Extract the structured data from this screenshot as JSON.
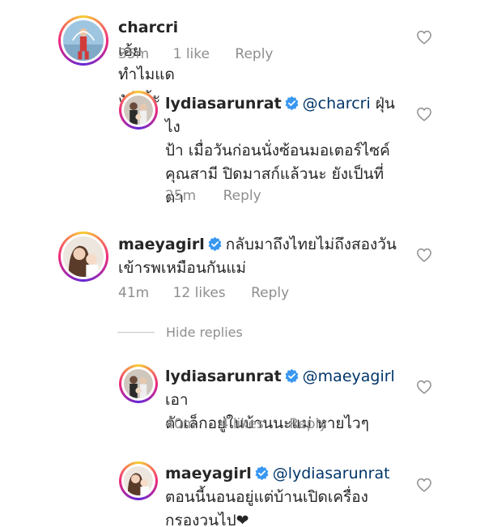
{
  "comments": [
    {
      "username": "charcri",
      "text": "เอ้ยทำไมแดงอ่ะจ้ะ",
      "time": "35m",
      "likes": "1 like",
      "reply_label": "Reply"
    },
    {
      "username": "lydiasarunrat",
      "mention": "@charcri",
      "line1": "ฝุ่นไง",
      "line2": "ป้า เมื่อวันก่อนนั่งซ้อนมอเตอร์ไซค์",
      "line3": "คุณสามี ปิดมาสก์แล้วนะ ยังเป็นที่",
      "line4": "ตา",
      "time": "25m",
      "reply_label": "Reply"
    },
    {
      "username": "maeyagirl",
      "line1": "กลับมาถึงไทยไม่ถึงสองวัน",
      "line2": "เข้ารพเหมือนกันแม่",
      "time": "41m",
      "likes": "12 likes",
      "reply_label": "Reply"
    },
    {
      "username": "lydiasarunrat",
      "mention": "@maeyagirl",
      "line1": "เอา",
      "line2": "ตัวเล็กอยู่ในบ้านนะแม่ หายไวๆ",
      "time": "40m",
      "likes": "4 likes",
      "reply_label": "Reply"
    },
    {
      "username": "maeyagirl",
      "mention": "@lydiasarunrat",
      "line2": "ตอนนี้นอนอยู่แต่บ้านเปิดเครื่อง",
      "line3": "กรองวนไป❤",
      "time": "",
      "reply_label": ""
    }
  ],
  "hide_replies_label": "Hide replies",
  "colors": {
    "verified": "#3897f0",
    "meta": "#8e8e8e",
    "text": "#262626",
    "mention": "#003569"
  },
  "icons": {
    "like": "heart-outline-icon",
    "verified": "verified-badge-icon"
  }
}
